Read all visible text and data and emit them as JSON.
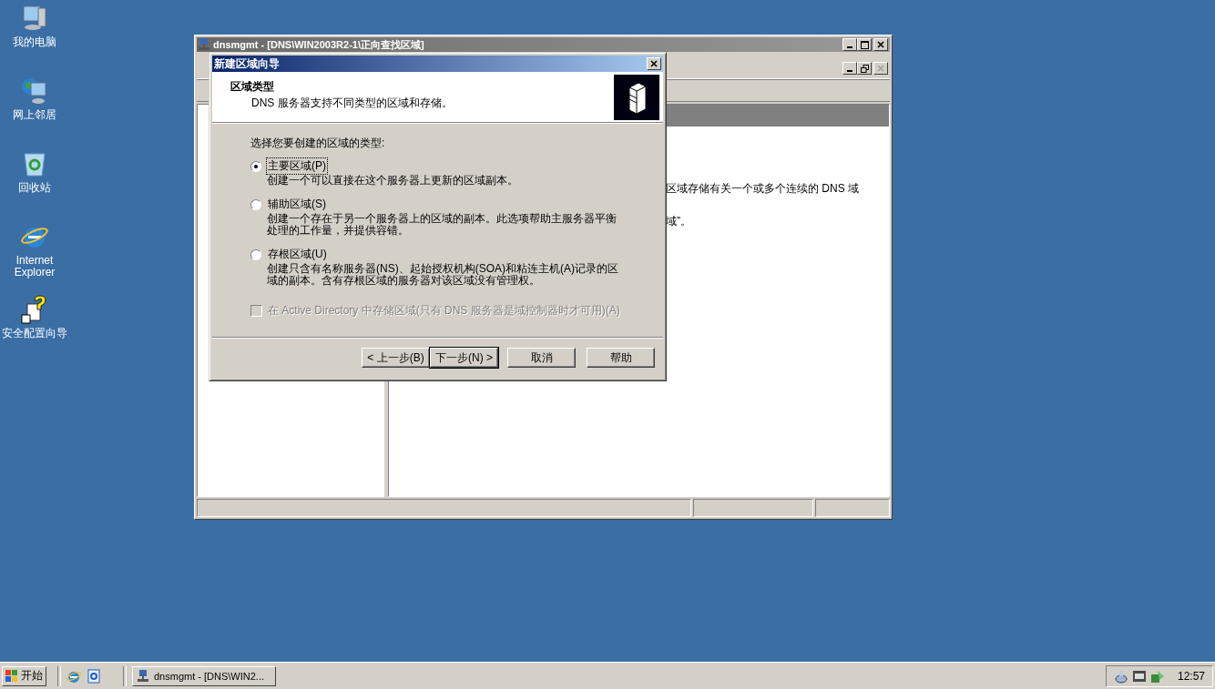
{
  "desktop_icons": [
    {
      "label": "我的电脑",
      "kind": "computer"
    },
    {
      "label": "网上邻居",
      "kind": "network"
    },
    {
      "label": "回收站",
      "kind": "recycle"
    },
    {
      "label": "Internet Explorer",
      "kind": "browser"
    },
    {
      "label": "安全配置向导",
      "kind": "wizard"
    }
  ],
  "mmc": {
    "title": "dnsmgmt - [DNS\\WIN2003R2-1\\正向查找区域]",
    "pane_text": [
      "区域存储有关一个或多个连续的 DNS 域",
      "域”。"
    ]
  },
  "wizard": {
    "title": "新建区域向导",
    "header_title": "区域类型",
    "header_subtitle": "DNS 服务器支持不同类型的区域和存储。",
    "prompt": "选择您要创建的区域的类型:",
    "zone_types": [
      {
        "label": "主要区域(P)",
        "description": "创建一个可以直接在这个服务器上更新的区域副本。",
        "selected": true
      },
      {
        "label": "辅助区域(S)",
        "description": "创建一个存在于另一个服务器上的区域的副本。此选项帮助主服务器平衡处理的工作量，并提供容错。",
        "selected": false
      },
      {
        "label": "存根区域(U)",
        "description": "创建只含有名称服务器(NS)、起始授权机构(SOA)和粘连主机(A)记录的区域的副本。含有存根区域的服务器对该区域没有管理权。",
        "selected": false
      }
    ],
    "ad_option": {
      "label": "在 Active Directory 中存储区域(只有 DNS 服务器是域控制器时才可用)(A)",
      "checked": false,
      "disabled": true
    },
    "buttons": [
      {
        "label": "< 上一步(B)",
        "default": false
      },
      {
        "label": "下一步(N) >",
        "default": true
      },
      {
        "label": "取消",
        "default": false
      },
      {
        "label": "帮助",
        "default": false
      }
    ]
  },
  "taskbar": {
    "start": "开始",
    "tasks": [
      {
        "label": "dnsmgmt - [DNS\\WIN2..."
      }
    ],
    "clock": "12:57"
  }
}
